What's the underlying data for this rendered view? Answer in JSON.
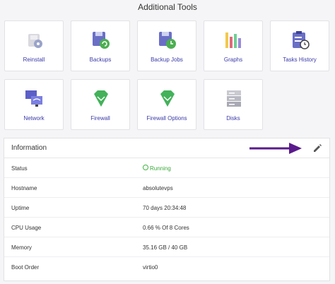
{
  "section_title": "Additional Tools",
  "tools": [
    {
      "label": "Reinstall",
      "icon": "reinstall-disk-icon"
    },
    {
      "label": "Backups",
      "icon": "backups-floppy-icon"
    },
    {
      "label": "Backup Jobs",
      "icon": "backup-jobs-floppy-icon"
    },
    {
      "label": "Graphs",
      "icon": "graphs-bars-icon"
    },
    {
      "label": "Tasks History",
      "icon": "tasks-history-clipboard-icon"
    },
    {
      "label": "Network",
      "icon": "network-monitors-icon"
    },
    {
      "label": "Firewall",
      "icon": "firewall-shield-icon"
    },
    {
      "label": "Firewall Options",
      "icon": "firewall-options-shield-icon"
    },
    {
      "label": "Disks",
      "icon": "disks-server-icon"
    }
  ],
  "info": {
    "title": "Information",
    "rows": [
      {
        "key": "Status",
        "value": "Running"
      },
      {
        "key": "Hostname",
        "value": "absolutevps"
      },
      {
        "key": "Uptime",
        "value": "70 days 20:34:48"
      },
      {
        "key": "CPU Usage",
        "value": "0.66 % Of 8 Cores"
      },
      {
        "key": "Memory",
        "value": "35.16 GB / 40 GB"
      },
      {
        "key": "Boot Order",
        "value": "virtio0"
      }
    ]
  },
  "colors": {
    "label_blue": "#3a3aa8",
    "running_green": "#3ba83b",
    "arrow_purple": "#5a1a8c"
  }
}
